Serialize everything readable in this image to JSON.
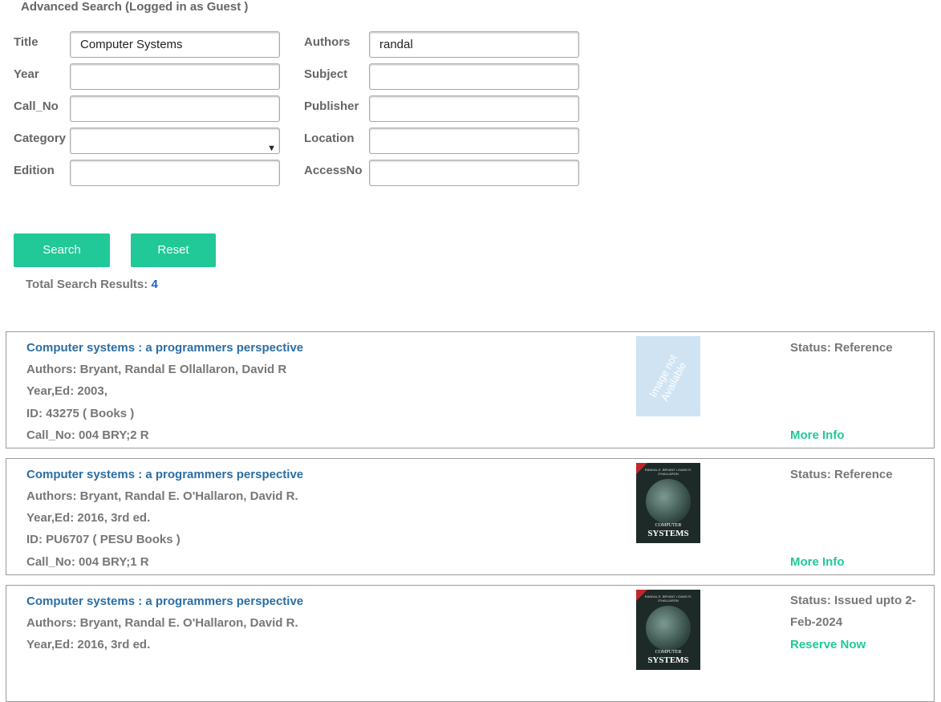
{
  "header": "Advanced Search (Logged in as Guest    )",
  "fields": [
    {
      "label": "Title",
      "value": "Computer Systems"
    },
    {
      "label": "Year",
      "value": ""
    },
    {
      "label": "Call_No",
      "value": ""
    },
    {
      "label": "Category",
      "value": ""
    },
    {
      "label": "Edition",
      "value": ""
    },
    {
      "label": "Authors",
      "value": "randal"
    },
    {
      "label": "Subject",
      "value": ""
    },
    {
      "label": "Publisher",
      "value": ""
    },
    {
      "label": "Location",
      "value": ""
    },
    {
      "label": "AccessNo",
      "value": ""
    }
  ],
  "buttons": {
    "search": "Search",
    "reset": "Reset"
  },
  "total": {
    "label": "Total Search Results:",
    "count": "4"
  },
  "results": [
    {
      "title": "Computer systems : a programmers perspective",
      "authors": "Authors: Bryant, Randal E Ollallaron, David R",
      "year": "Year,Ed:  2003,",
      "id": "ID:  43275 ( Books )",
      "callno": "Call_No: 004 BRY;2 R",
      "status": "Status: Reference",
      "link": "More Info",
      "thumb": "Image not Available"
    },
    {
      "title": "Computer systems : a programmers perspective",
      "authors": "Authors: Bryant, Randal E. O'Hallaron, David R.",
      "year": "Year,Ed:  2016, 3rd ed.",
      "id": "ID:  PU6707 ( PESU Books )",
      "callno": "Call_No: 004 BRY;1 R",
      "status": "Status: Reference",
      "link": "More Info",
      "cover": {
        "top": "RANDAL E. BRYANT  •  DAVID R. O'HALLARON",
        "small": "COMPUTER",
        "big": "SYSTEMS"
      }
    },
    {
      "title": "Computer systems : a programmers perspective",
      "authors": "Authors: Bryant, Randal E. O'Hallaron, David R.",
      "year": "Year,Ed:  2016, 3rd ed.",
      "status": "Status: Issued upto 2-Feb-2024",
      "link": "Reserve Now",
      "cover": {
        "top": "RANDAL E. BRYANT  •  DAVID R. O'HALLARON",
        "small": "COMPUTER",
        "big": "SYSTEMS"
      }
    }
  ],
  "colors": {
    "accent": "#20c997",
    "title_link": "#2b6ea5",
    "count": "#1e60d0"
  }
}
